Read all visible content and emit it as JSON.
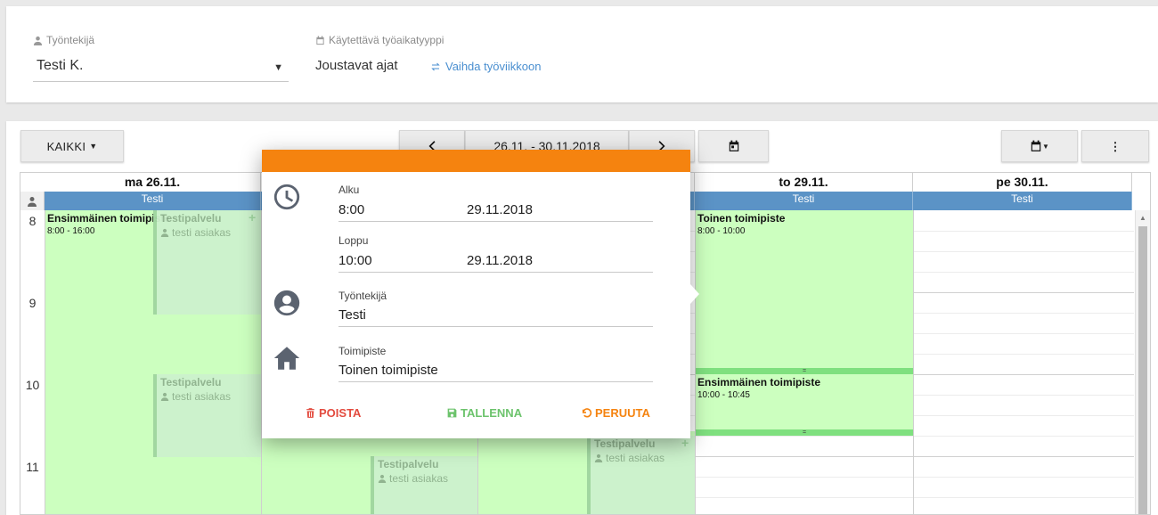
{
  "filters": {
    "employee_label": "Työntekijä",
    "employee_value": "Testi K.",
    "worktime_label": "Käytettävä työaikatyyppi",
    "worktime_value": "Joustavat ajat",
    "switch_link": "Vaihda työviikkoon"
  },
  "toolbar": {
    "all_button": "KAIKKI",
    "date_range": "26.11. - 30.11.2018"
  },
  "calendar": {
    "days": [
      {
        "label": "ma 26.11.",
        "resource": "Testi"
      },
      {
        "label": "",
        "resource": ""
      },
      {
        "label": "",
        "resource": ""
      },
      {
        "label": "to 29.11.",
        "resource": "Testi"
      },
      {
        "label": "pe 30.11.",
        "resource": "Testi"
      }
    ],
    "hours": [
      "8",
      "9",
      "10",
      "11"
    ],
    "events": [
      {
        "title": "Ensimmäinen toimipiste",
        "time": "8:00 - 16:00"
      },
      {
        "title": "Toinen toimipiste",
        "time": "8:00 - 10:00"
      },
      {
        "title": "Ensimmäinen toimipiste",
        "time": "10:00 - 10:45"
      }
    ],
    "services": [
      {
        "title": "Testipalvelu",
        "customer": "testi asiakas"
      },
      {
        "title": "Testipalvelu",
        "customer": "testi asiakas"
      },
      {
        "title": "Testipalvelu",
        "customer": "testi asiakas"
      },
      {
        "title": "Testipalvelu",
        "customer": "testi asiakas"
      }
    ],
    "bar_mark": "="
  },
  "popup": {
    "start_label": "Alku",
    "start_time": "8:00",
    "start_date": "29.11.2018",
    "end_label": "Loppu",
    "end_time": "10:00",
    "end_date": "29.11.2018",
    "employee_label": "Työntekijä",
    "employee_value": "Testi",
    "location_label": "Toimipiste",
    "location_value": "Toinen toimipiste",
    "delete_label": "POISTA",
    "save_label": "TALLENNA",
    "cancel_label": "PERUUTA",
    "colors": {
      "header": "#f5830f",
      "delete": "#e34b3f",
      "save": "#6cc36c",
      "cancel": "#f5830f"
    }
  }
}
